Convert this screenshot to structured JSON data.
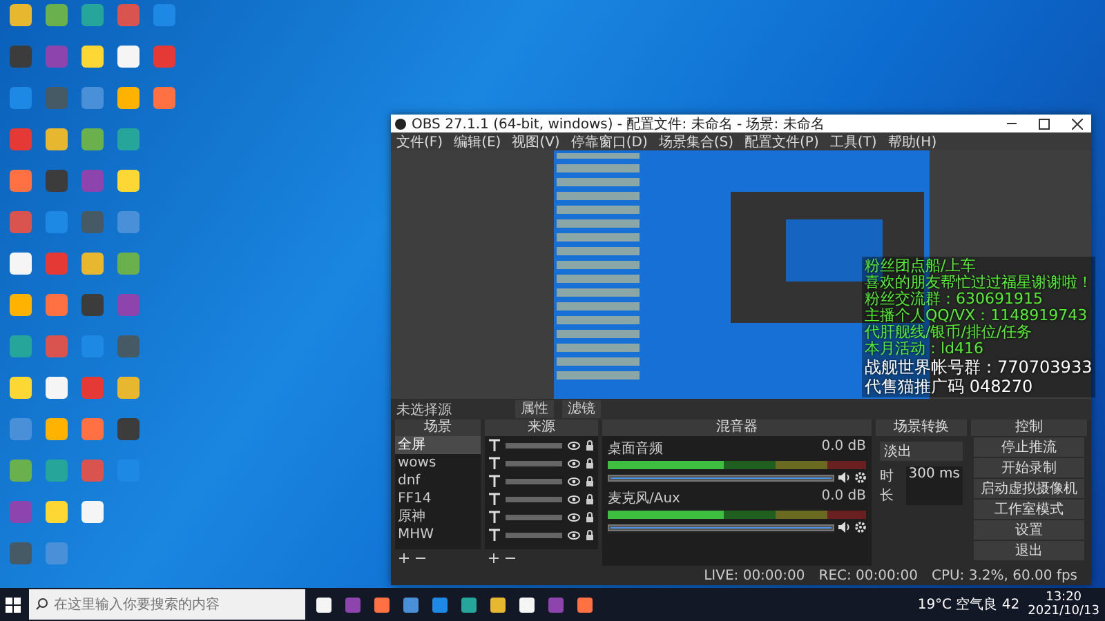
{
  "obs_window": {
    "title": "OBS 27.1.1 (64-bit, windows) - 配置文件: 未命名 - 场景: 未命名",
    "menu": [
      "文件(F)",
      "编辑(E)",
      "视图(V)",
      "停靠窗口(D)",
      "场景集合(S)",
      "配置文件(P)",
      "工具(T)",
      "帮助(H)"
    ],
    "source_toolbar": {
      "label": "未选择源",
      "buttons": [
        "属性",
        "滤镜"
      ]
    },
    "scenes": {
      "title": "场景",
      "items": [
        {
          "name": "全屏",
          "selected": true
        },
        {
          "name": "wows",
          "selected": false
        },
        {
          "name": "dnf",
          "selected": false
        },
        {
          "name": "FF14",
          "selected": false
        },
        {
          "name": "原神",
          "selected": false
        },
        {
          "name": "MHW",
          "selected": false
        }
      ]
    },
    "sources": {
      "title": "来源"
    },
    "mixer": {
      "title": "混音器",
      "channels": [
        {
          "name": "桌面音频",
          "reading": "0.0 dB",
          "level": 1
        },
        {
          "name": "麦克风/Aux",
          "reading": "0.0 dB",
          "level": 1
        }
      ]
    },
    "transitions": {
      "title": "场景转换",
      "type": "淡出",
      "duration_label": "时长",
      "duration": "300 ms"
    },
    "controls": {
      "title": "控制",
      "buttons": [
        "停止推流",
        "开始录制",
        "启动虚拟摄像机",
        "工作室模式",
        "设置",
        "退出"
      ]
    },
    "status_bar": [
      "LIVE: 00:00:00",
      "REC: 00:00:00",
      "CPU: 3.2%, 60.00 fps"
    ]
  },
  "overlay_text": [
    "粉丝团点船/上车",
    "喜欢的朋友帮忙过过福星谢谢啦！",
    "粉丝交流群：630691915",
    "主播个人QQ/VX：1148919743",
    "代肝舰线/银币/排位/任务",
    "本月活动：ld416",
    "战舰世界帐号群：770703933",
    "代售猫推广码 048270"
  ],
  "taskbar": {
    "search_placeholder": "在这里输入你要搜索的内容",
    "weather": "19°C 空气良 42",
    "time": "13:20",
    "date": "2021/10/13"
  }
}
